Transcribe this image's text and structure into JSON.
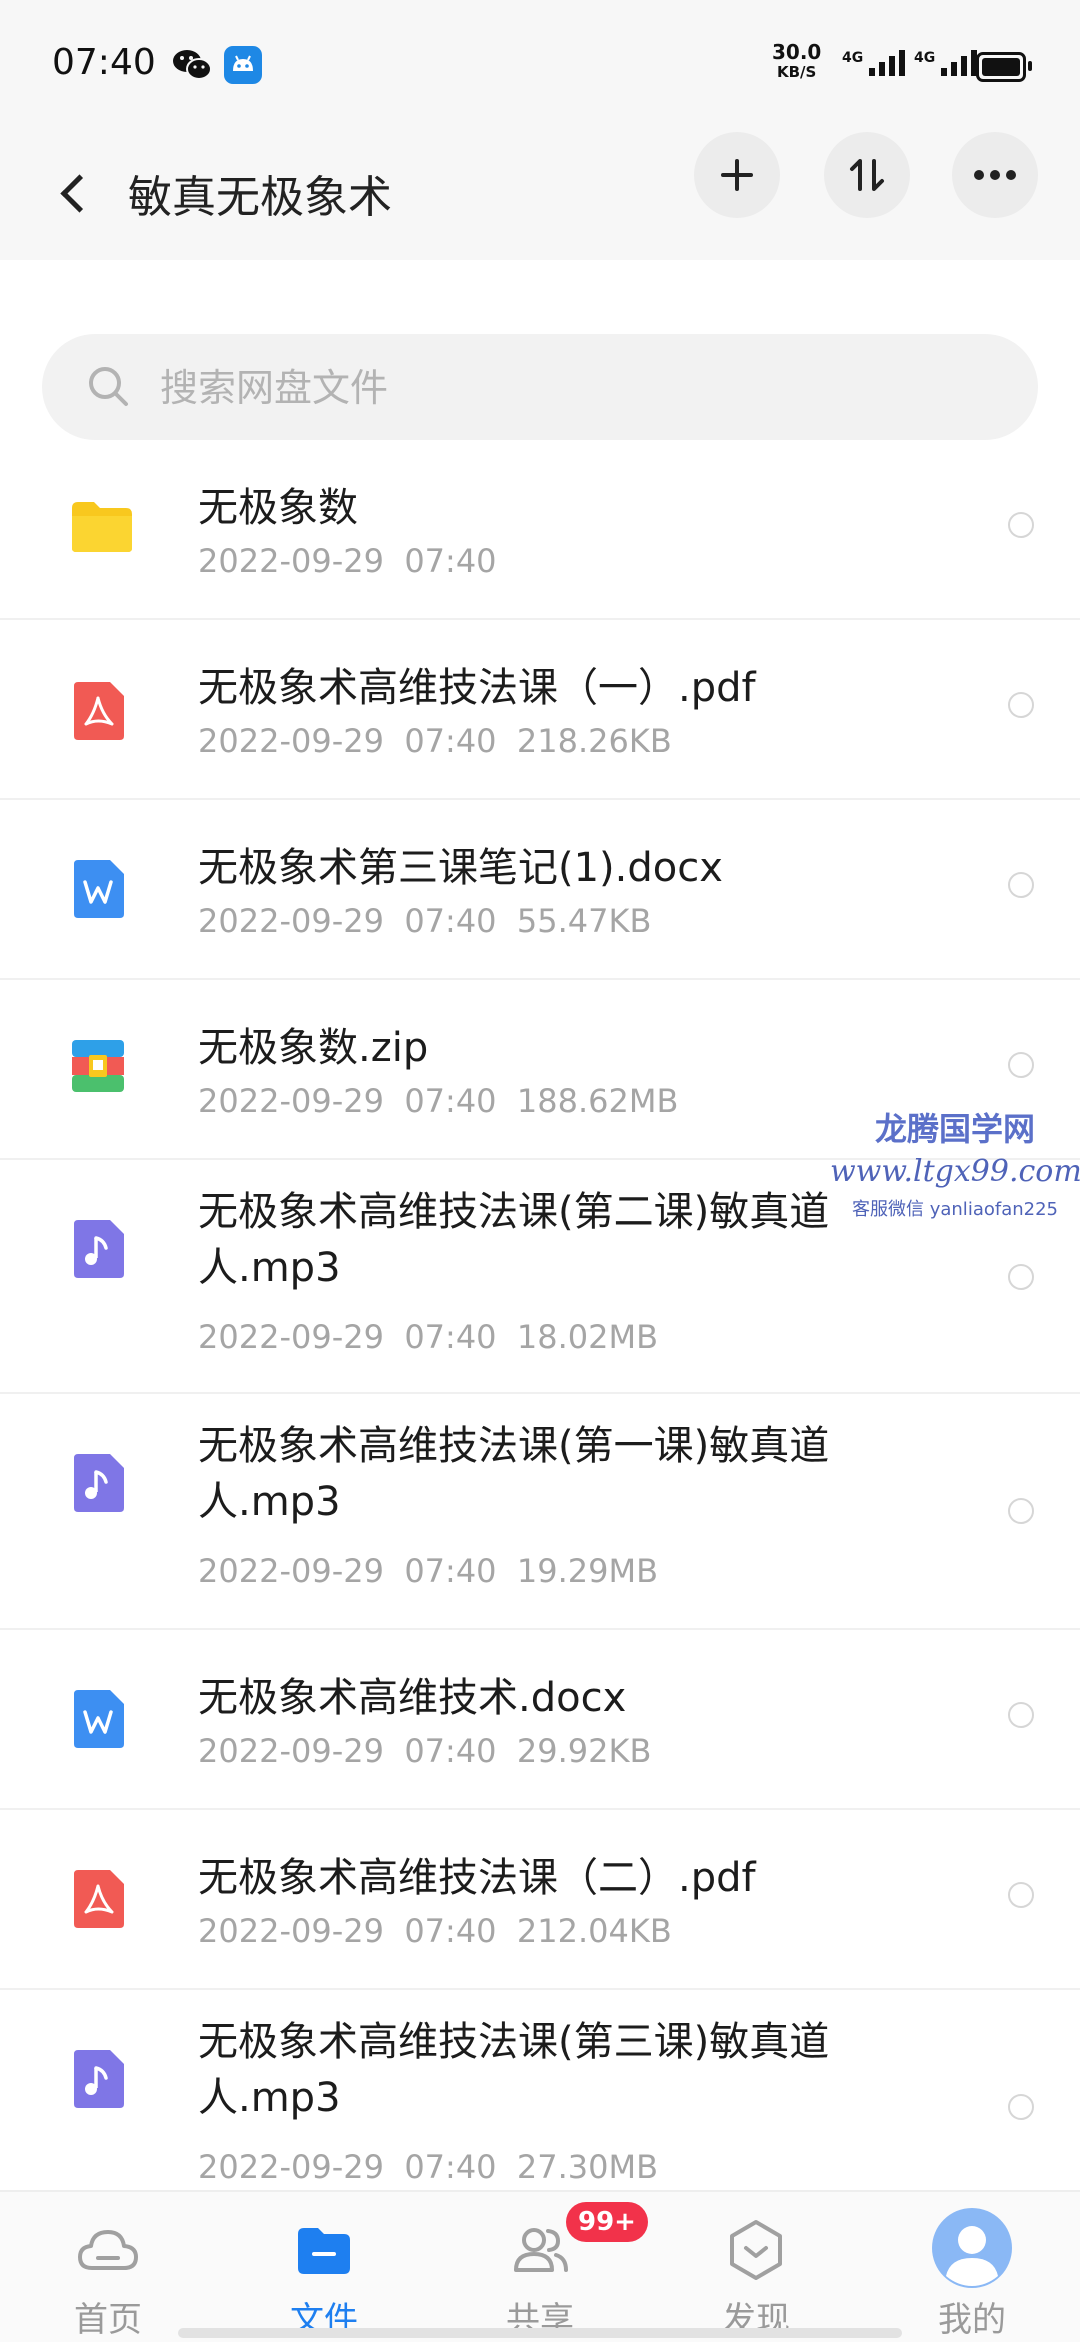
{
  "status_bar": {
    "time": "07:40",
    "net_speed": "30.0",
    "net_unit": "KB/S",
    "signal1_label": "4G",
    "signal2_label": "4G"
  },
  "header": {
    "title": "敏真无极象术",
    "icons": {
      "back": "back-arrow-icon",
      "add": "plus-icon",
      "sort": "sort-icon",
      "more": "more-icon"
    }
  },
  "search": {
    "placeholder": "搜索网盘文件"
  },
  "files": [
    {
      "name": "无极象数",
      "date": "2022-09-29  07:40",
      "size": "",
      "type": "folder"
    },
    {
      "name": "无极象术高维技法课（一）.pdf",
      "date": "2022-09-29  07:40",
      "size": "218.26KB",
      "type": "pdf"
    },
    {
      "name": "无极象术第三课笔记(1).docx",
      "date": "2022-09-29  07:40",
      "size": "55.47KB",
      "type": "word"
    },
    {
      "name": "无极象数.zip",
      "date": "2022-09-29  07:40",
      "size": "188.62MB",
      "type": "zip"
    },
    {
      "name": "无极象术高维技法课(第二课)敏真道人.mp3",
      "date": "2022-09-29  07:40",
      "size": "18.02MB",
      "type": "audio"
    },
    {
      "name": "无极象术高维技法课(第一课)敏真道人.mp3",
      "date": "2022-09-29  07:40",
      "size": "19.29MB",
      "type": "audio"
    },
    {
      "name": "无极象术高维技术.docx",
      "date": "2022-09-29  07:40",
      "size": "29.92KB",
      "type": "word"
    },
    {
      "name": "无极象术高维技法课（二）.pdf",
      "date": "2022-09-29  07:40",
      "size": "212.04KB",
      "type": "pdf"
    },
    {
      "name": "无极象术高维技法课(第三课)敏真道人.mp3",
      "date": "2022-09-29  07:40",
      "size": "27.30MB",
      "type": "audio"
    }
  ],
  "watermark": {
    "line1": "龙腾国学网",
    "line2": "www.ltgx99.com",
    "line3": "客服微信 yanliaofan225"
  },
  "bottom_nav": {
    "tabs": [
      {
        "label": "首页",
        "icon": "cloud-icon"
      },
      {
        "label": "文件",
        "icon": "folder-icon"
      },
      {
        "label": "共享",
        "icon": "people-icon"
      },
      {
        "label": "发现",
        "icon": "discover-icon"
      },
      {
        "label": "我的",
        "icon": "avatar-icon"
      }
    ],
    "active_tab": "文件",
    "share_badge": "99+"
  },
  "colors": {
    "accent": "#1e7ff0",
    "folder": "#f8c81e",
    "pdf": "#f15a54",
    "word": "#3d8ff2",
    "audio": "#7f76e6",
    "badge": "#f2324a"
  }
}
